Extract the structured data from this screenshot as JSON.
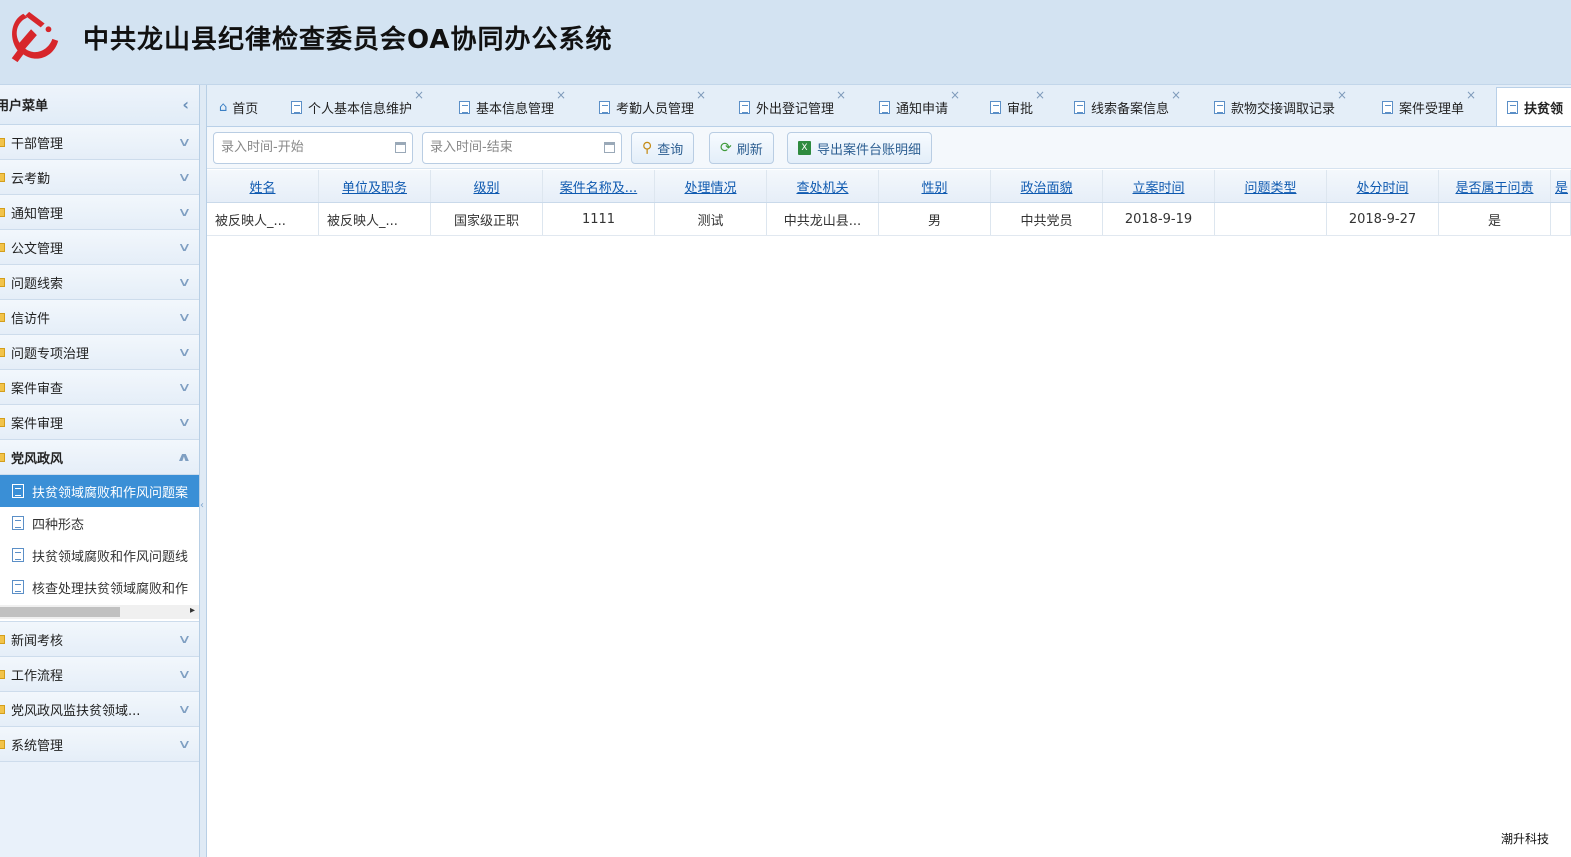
{
  "app": {
    "title": "中共龙山县纪律检查委员会OA协同办公系统"
  },
  "sidebar": {
    "title": "用户菜单",
    "groups_before": [
      {
        "label": "干部管理"
      },
      {
        "label": "云考勤"
      },
      {
        "label": "通知管理"
      },
      {
        "label": "公文管理"
      },
      {
        "label": "问题线索"
      },
      {
        "label": "信访件"
      },
      {
        "label": "问题专项治理"
      },
      {
        "label": "案件审查"
      },
      {
        "label": "案件审理"
      }
    ],
    "open_group": {
      "label": "党风政风"
    },
    "sub_items": [
      {
        "label": "扶贫领域腐败和作风问题案"
      },
      {
        "label": "四种形态"
      },
      {
        "label": "扶贫领域腐败和作风问题线"
      },
      {
        "label": "核查处理扶贫领域腐败和作"
      }
    ],
    "groups_after": [
      {
        "label": "新闻考核"
      },
      {
        "label": "工作流程"
      },
      {
        "label": "党风政风监扶贫领域..."
      },
      {
        "label": "系统管理"
      }
    ]
  },
  "tabs": [
    {
      "label": "首页"
    },
    {
      "label": "个人基本信息维护"
    },
    {
      "label": "基本信息管理"
    },
    {
      "label": "考勤人员管理"
    },
    {
      "label": "外出登记管理"
    },
    {
      "label": "通知申请"
    },
    {
      "label": "审批"
    },
    {
      "label": "线索备案信息"
    },
    {
      "label": "款物交接调取记录"
    },
    {
      "label": "案件受理单"
    },
    {
      "label": "扶贫领"
    }
  ],
  "toolbar": {
    "start_placeholder": "录入时间-开始",
    "end_placeholder": "录入时间-结束",
    "query_label": "查询",
    "refresh_label": "刷新",
    "export_label": "导出案件台账明细"
  },
  "grid": {
    "columns": [
      "姓名",
      "单位及职务",
      "级别",
      "案件名称及...",
      "处理情况",
      "查处机关",
      "性别",
      "政治面貌",
      "立案时间",
      "问题类型",
      "处分时间",
      "是否属于问责",
      "是"
    ],
    "rows": [
      [
        "被反映人_...",
        "被反映人_...",
        "国家级正职",
        "1111",
        "测试",
        "中共龙山县...",
        "男",
        "中共党员",
        "2018-9-19",
        "",
        "2018-9-27",
        "是",
        ""
      ]
    ]
  },
  "footer": {
    "brand": "潮升科技"
  },
  "colors": {
    "accent": "#3a8fd6",
    "header_bg": "#d3e3f2",
    "link": "#0f5ab0"
  }
}
